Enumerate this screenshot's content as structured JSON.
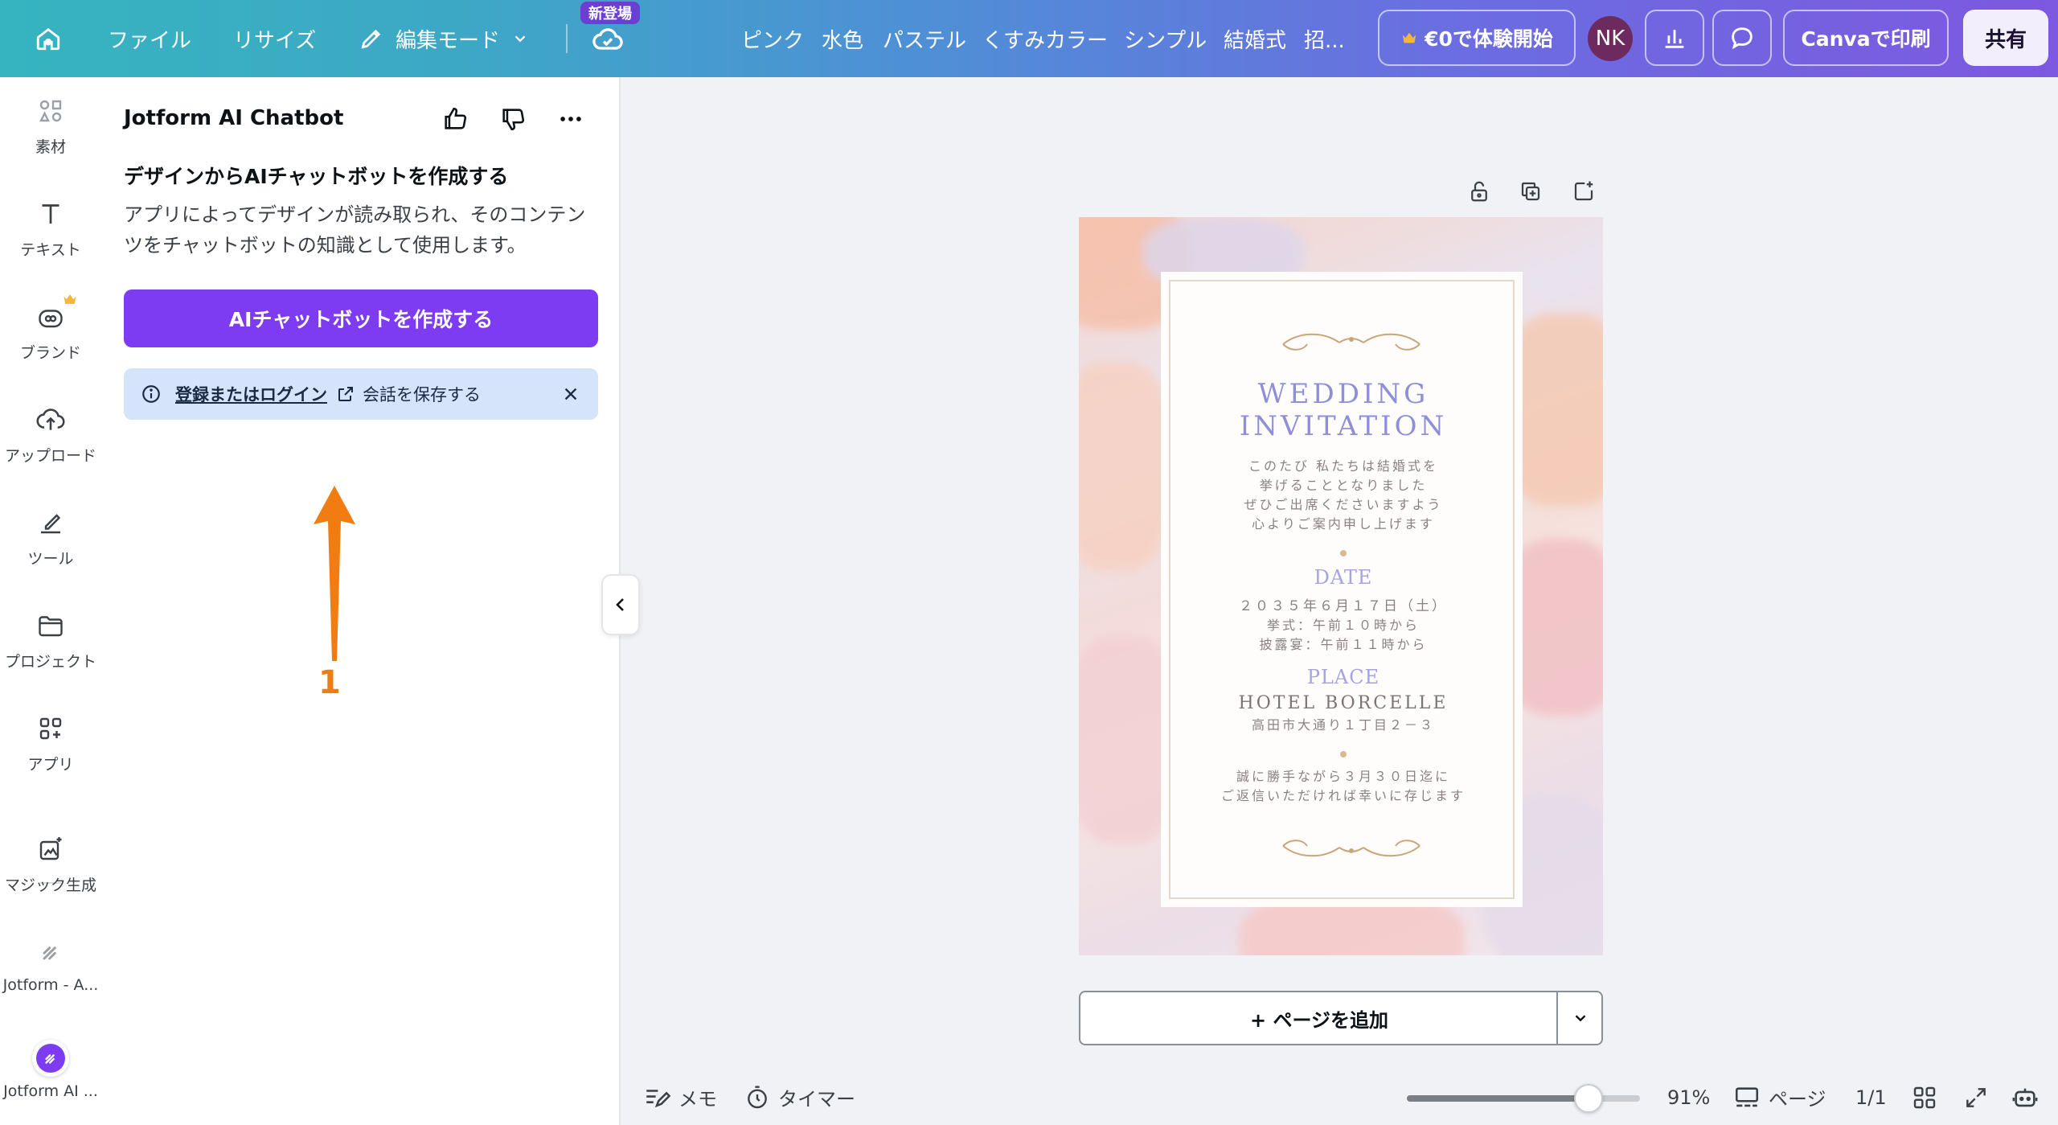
{
  "topbar": {
    "file": "ファイル",
    "resize": "リサイズ",
    "edit_mode": "編集モード",
    "new_badge": "新登場",
    "tags": [
      "ピンク",
      "水色",
      "パステル",
      "くすみカラー",
      "シンプル",
      "結婚式",
      "招..."
    ],
    "trial": "€0で体験開始",
    "avatar": "NK",
    "print": "Canvaで印刷",
    "share": "共有"
  },
  "rail": {
    "items": [
      {
        "label": "素材",
        "icon": "elements-icon"
      },
      {
        "label": "テキスト",
        "icon": "text-icon"
      },
      {
        "label": "ブランド",
        "icon": "brand-icon"
      },
      {
        "label": "アップロード",
        "icon": "upload-icon"
      },
      {
        "label": "ツール",
        "icon": "tools-icon"
      },
      {
        "label": "プロジェクト",
        "icon": "folder-icon"
      },
      {
        "label": "アプリ",
        "icon": "apps-icon"
      },
      {
        "label": "マジック生成",
        "icon": "magic-icon"
      },
      {
        "label": "Jotform - A...",
        "icon": "jotform-icon"
      },
      {
        "label": "Jotform AI ...",
        "icon": "jotform-ai-icon"
      }
    ]
  },
  "panel": {
    "title": "Jotform AI Chatbot",
    "heading": "デザインからAIチャットボットを作成する",
    "description": "アプリによってデザインが読み取られ、そのコンテンツをチャットボットの知識として使用します。",
    "create_button": "AIチャットボットを作成する",
    "notice_link": "登録またはログイン",
    "notice_rest": "会話を保存する",
    "annotation_number": "1"
  },
  "design": {
    "title_line1": "WEDDING",
    "title_line2": "INVITATION",
    "intro": [
      "このたび 私たちは結婚式を",
      "挙げることとなりました",
      "ぜひご出席くださいますよう",
      "心よりご案内申し上げます"
    ],
    "date_heading": "DATE",
    "date_lines": [
      "２０３５年６月１７日（土）",
      "挙式：午前１０時から",
      "披露宴：午前１１時から"
    ],
    "place_heading": "PLACE",
    "hotel": "HOTEL BORCELLE",
    "address": "高田市大通り１丁目２－３",
    "closing": [
      "誠に勝手ながら３月３０日迄に",
      "ご返信いただければ幸いに存じます"
    ]
  },
  "add_page": "+ ページを追加",
  "bottombar": {
    "notes": "メモ",
    "timer": "タイマー",
    "zoom": "91%",
    "zoom_level": 0.78,
    "pages_label": "ページ",
    "page_count": "1/1"
  },
  "colors": {
    "primary": "#7d3bf2",
    "notice_bg": "#d5e3fb",
    "annotation": "#f07c12",
    "avatar": "#6d2a5e"
  }
}
